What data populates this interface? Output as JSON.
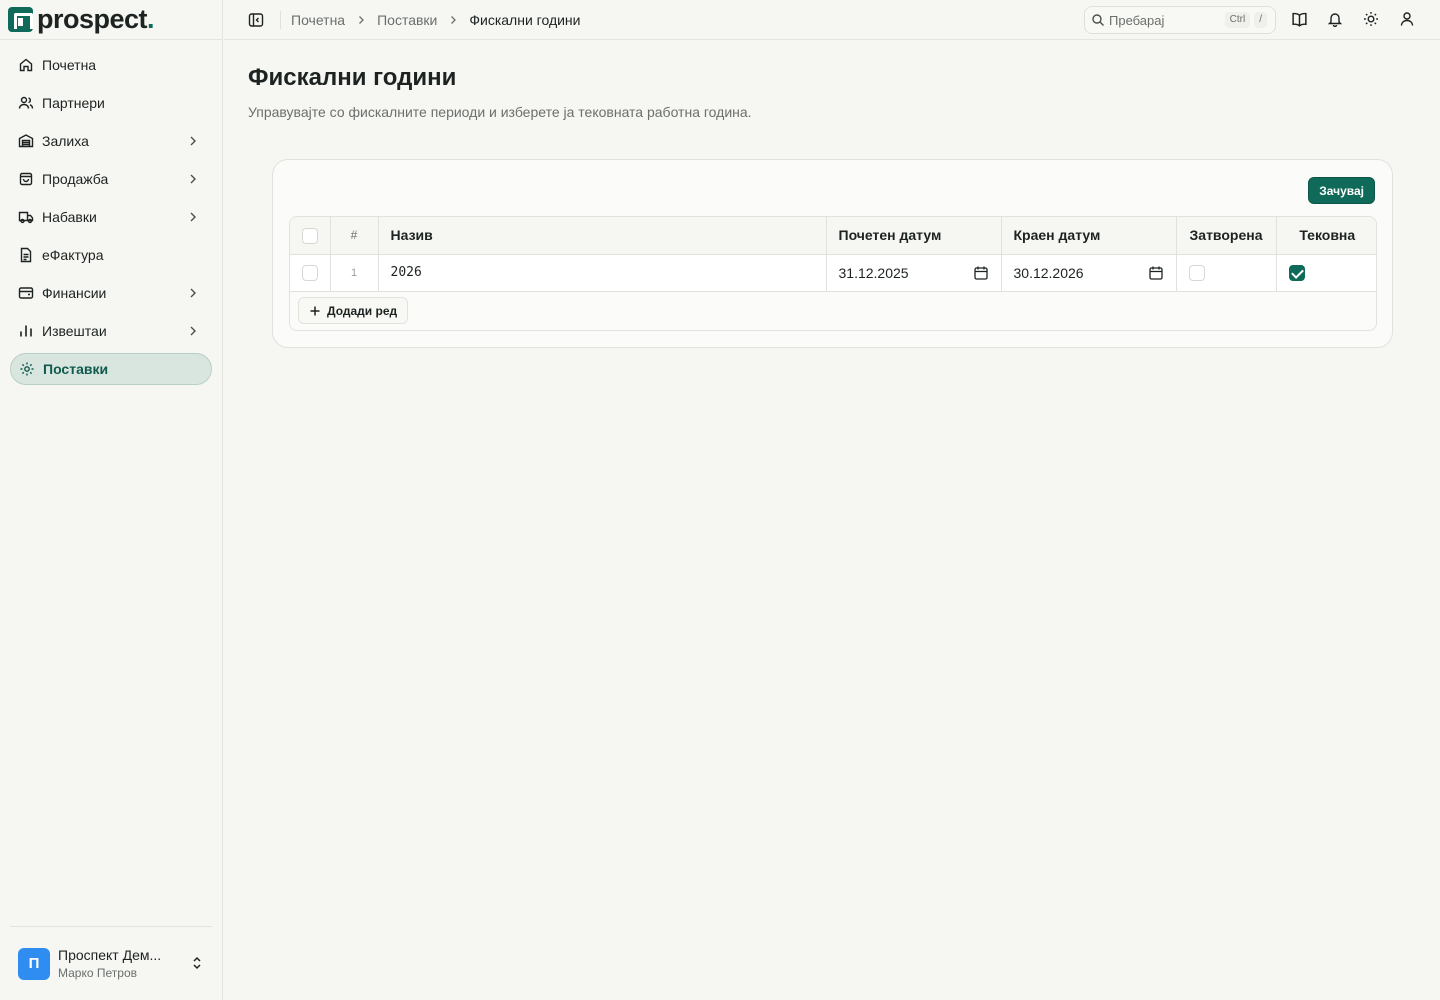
{
  "app": {
    "logo_text": "prospect",
    "logo_dot": ".",
    "brand_color": "#0f6a5a"
  },
  "sidebar": {
    "items": [
      {
        "label": "Почетна",
        "icon": "home-icon",
        "has_children": false
      },
      {
        "label": "Партнери",
        "icon": "users-icon",
        "has_children": false
      },
      {
        "label": "Залиха",
        "icon": "warehouse-icon",
        "has_children": true
      },
      {
        "label": "Продажба",
        "icon": "shopping-bag-icon",
        "has_children": true
      },
      {
        "label": "Набавки",
        "icon": "truck-icon",
        "has_children": true
      },
      {
        "label": "еФактура",
        "icon": "document-icon",
        "has_children": false
      },
      {
        "label": "Финансии",
        "icon": "wallet-icon",
        "has_children": true
      },
      {
        "label": "Извештаи",
        "icon": "bar-chart-icon",
        "has_children": true
      },
      {
        "label": "Поставки",
        "icon": "gear-icon",
        "has_children": false,
        "active": true
      }
    ],
    "footer": {
      "avatar_letter": "П",
      "company": "Проспект Дем...",
      "user": "Марко Петров"
    }
  },
  "topbar": {
    "breadcrumb": [
      "Почетна",
      "Поставки",
      "Фискални години"
    ],
    "search_placeholder": "Пребарај",
    "search_kbd": [
      "Ctrl",
      "/"
    ]
  },
  "page": {
    "title": "Фискални години",
    "subtitle": "Управувајте со фискалните периоди и изберете ја тековната работна година."
  },
  "table": {
    "save_label": "Зачувај",
    "headers": {
      "num": "#",
      "name": "Назив",
      "start": "Почетен датум",
      "end": "Краен датум",
      "closed": "Затворена",
      "current": "Тековна"
    },
    "rows": [
      {
        "num": "1",
        "name": "2026",
        "start": "31.12.2025",
        "end": "30.12.2026",
        "closed": false,
        "current": true
      }
    ],
    "add_row_label": "Додади ред"
  }
}
